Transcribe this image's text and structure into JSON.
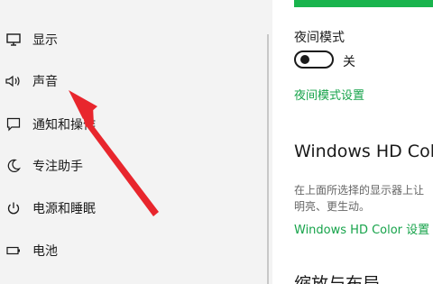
{
  "sidebar": {
    "items": [
      {
        "icon": "monitor-icon",
        "label": "显示"
      },
      {
        "icon": "speaker-icon",
        "label": "声音"
      },
      {
        "icon": "notification-icon",
        "label": "通知和操作"
      },
      {
        "icon": "moon-icon",
        "label": "专注助手"
      },
      {
        "icon": "power-icon",
        "label": "电源和睡眠"
      },
      {
        "icon": "battery-icon",
        "label": "电池"
      }
    ]
  },
  "main": {
    "night_light_label": "夜间模式",
    "night_light_state": "关",
    "night_light_settings_link": "夜间模式设置",
    "hd_color_heading": "Windows HD Color",
    "hd_color_desc_line1": "在上面所选择的显示器上让",
    "hd_color_desc_line2": "明亮、更生动。",
    "hd_color_settings_link": "Windows HD Color 设置",
    "scale_layout_heading": "缩放与布局"
  },
  "colors": {
    "accent": "#16a34a",
    "annotation_arrow": "#e8262d",
    "sidebar_bg": "#f3f3f3"
  }
}
